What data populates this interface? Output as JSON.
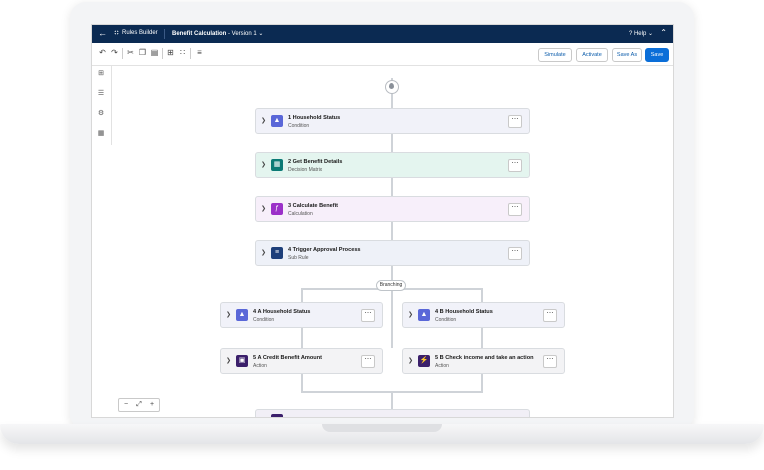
{
  "header": {
    "app_name": "Rules Builder",
    "title": "Benefit Calculation",
    "version": " - Version 1",
    "help_label": "Help"
  },
  "toolbar": {
    "simulate": "Simulate",
    "activate": "Activate",
    "save_as": "Save As",
    "save": "Save"
  },
  "flow": {
    "branching_label": "Branching",
    "steps": [
      {
        "title": "1  Household Status",
        "subtitle": "Condition"
      },
      {
        "title": "2  Get Benefit Details",
        "subtitle": "Decision Matrix"
      },
      {
        "title": "3 Calculate Benefit",
        "subtitle": "Calculation"
      },
      {
        "title": "4  Trigger Approval Process",
        "subtitle": "Sub Rule"
      }
    ],
    "left_branch": [
      {
        "title": "4 A  Household Status",
        "subtitle": "Condition"
      },
      {
        "title": "5 A Credit Benefit Amount",
        "subtitle": "Action"
      }
    ],
    "right_branch": [
      {
        "title": "4 B  Household Status",
        "subtitle": "Condition"
      },
      {
        "title": "5 B Check income and take an action",
        "subtitle": "Action"
      }
    ]
  },
  "colors": {
    "header_bg": "#0b2a52",
    "condition": "#5a67d8",
    "matrix": "#0b7a75",
    "calculation": "#9b30c8",
    "subrule": "#1e3f7a",
    "action": "#3b1f6b"
  }
}
